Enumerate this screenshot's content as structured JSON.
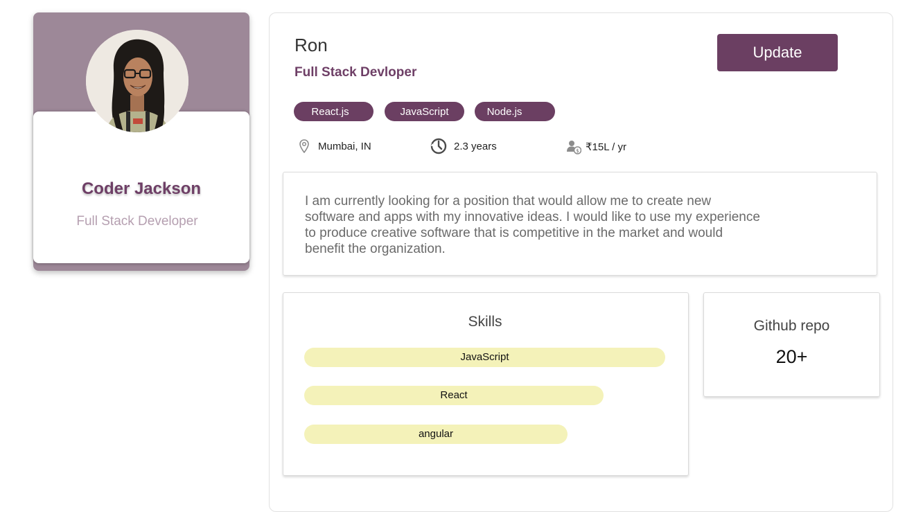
{
  "profile_card": {
    "name": "Coder Jackson",
    "role": "Full Stack Developer",
    "header_color": "#9d8898"
  },
  "header": {
    "name": "Ron",
    "title": "Full Stack Devloper",
    "update_label": "Update"
  },
  "tags": [
    "React.js",
    "JavaScript",
    "Node.js"
  ],
  "meta": {
    "location": {
      "icon": "location-pin-icon",
      "text": "Mumbai, IN"
    },
    "experience": {
      "icon": "clock-icon",
      "text": "2.3 years"
    },
    "salary": {
      "icon": "salary-user-icon",
      "text": "₹15L / yr"
    }
  },
  "about": "I am currently looking for a position that would allow me to create new software and apps with my innovative ideas. I would like to use my experience to produce creative software that is competitive in the market and would benefit the organization.",
  "skills": {
    "title": "Skills",
    "items": [
      {
        "label": "JavaScript",
        "level": 1.0
      },
      {
        "label": "React",
        "level": 0.83
      },
      {
        "label": "angular",
        "level": 0.73
      }
    ]
  },
  "github": {
    "title": "Github repo",
    "count": "20+"
  },
  "colors": {
    "accent": "#6b3f62",
    "skill_bar": "#f4f2b9"
  }
}
